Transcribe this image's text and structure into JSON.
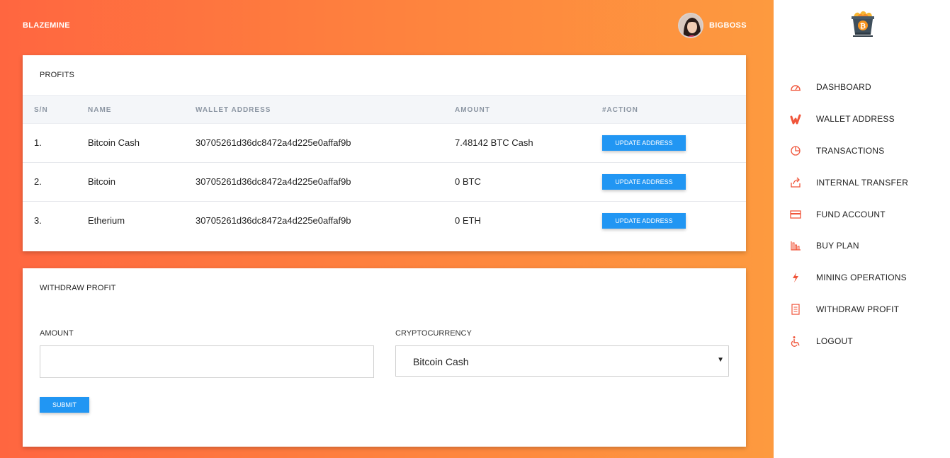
{
  "header": {
    "brand": "BLAZEMINE",
    "username": "BIGBOSS"
  },
  "profits": {
    "title": "PROFITS",
    "columns": [
      "S/N",
      "NAME",
      "WALLET ADDRESS",
      "AMOUNT",
      "#ACTION"
    ],
    "rows": [
      {
        "sn": "1.",
        "name": "Bitcoin Cash",
        "wallet": "30705261d36dc8472a4d225e0affaf9b",
        "amount": "7.48142 BTC Cash",
        "action": "UPDATE ADDRESS"
      },
      {
        "sn": "2.",
        "name": "Bitcoin",
        "wallet": "30705261d36dc8472a4d225e0affaf9b",
        "amount": "0 BTC",
        "action": "UPDATE ADDRESS"
      },
      {
        "sn": "3.",
        "name": "Etherium",
        "wallet": "30705261d36dc8472a4d225e0affaf9b",
        "amount": "0 ETH",
        "action": "UPDATE ADDRESS"
      }
    ]
  },
  "withdraw": {
    "title": "WITHDRAW PROFIT",
    "amount_label": "AMOUNT",
    "amount_value": "",
    "crypto_label": "CRYPTOCURRENCY",
    "crypto_selected": "Bitcoin Cash",
    "submit_label": "SUBMIT"
  },
  "sidebar": {
    "items": [
      {
        "label": "DASHBOARD",
        "icon": "speedometer-icon"
      },
      {
        "label": "WALLET ADDRESS",
        "icon": "wallet-icon"
      },
      {
        "label": "TRANSACTIONS",
        "icon": "pie-chart-icon"
      },
      {
        "label": "INTERNAL TRANSFER",
        "icon": "share-icon"
      },
      {
        "label": "FUND ACCOUNT",
        "icon": "credit-card-icon"
      },
      {
        "label": "BUY PLAN",
        "icon": "bar-chart-icon"
      },
      {
        "label": "MINING OPERATIONS",
        "icon": "lightning-icon"
      },
      {
        "label": "WITHDRAW PROFIT",
        "icon": "receipt-icon"
      },
      {
        "label": "LOGOUT",
        "icon": "accessibility-icon"
      }
    ]
  },
  "colors": {
    "gradient_start": "#ff6640",
    "gradient_end": "#fd9a3f",
    "button_blue": "#2196f3",
    "icon_accent": "#f0553a"
  }
}
